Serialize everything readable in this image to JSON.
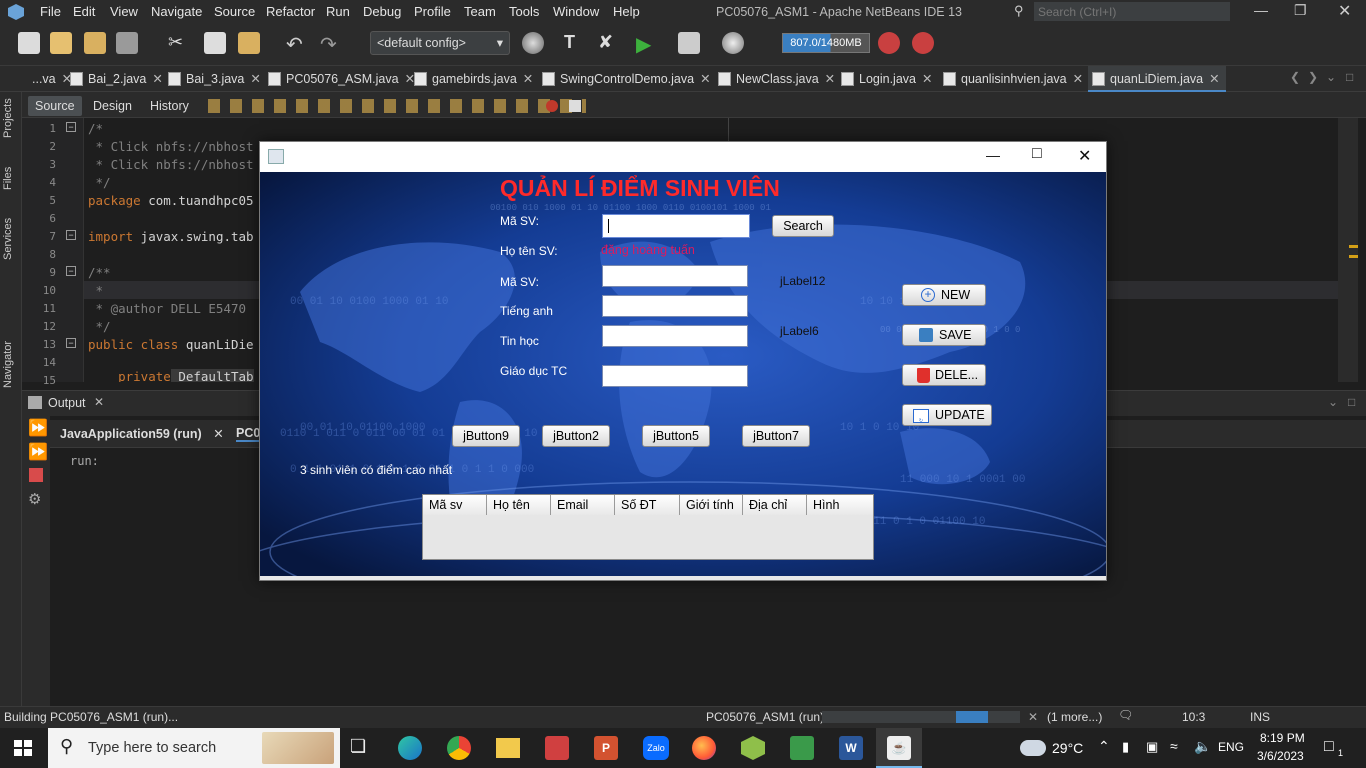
{
  "window": {
    "title": "PC05076_ASM1 - Apache NetBeans IDE 13",
    "search_placeholder": "Search (Ctrl+I)"
  },
  "menu": [
    "File",
    "Edit",
    "View",
    "Navigate",
    "Source",
    "Refactor",
    "Run",
    "Debug",
    "Profile",
    "Team",
    "Tools",
    "Window",
    "Help"
  ],
  "toolbar": {
    "config": "<default config>",
    "memory": "807.0/1480MB"
  },
  "editor_tabs": [
    "...va",
    "Bai_2.java",
    "Bai_3.java",
    "PC05076_ASM.java",
    "gamebirds.java",
    "SwingControlDemo.java",
    "NewClass.java",
    "Login.java",
    "quanlisinhvien.java",
    "quanLiDiem.java"
  ],
  "editor_subtabs": [
    "Source",
    "Design",
    "History"
  ],
  "side_tabs": [
    "Projects",
    "Files",
    "Services",
    "Navigator"
  ],
  "code": {
    "lines": [
      "1",
      "2",
      "3",
      "4",
      "5",
      "6",
      "7",
      "8",
      "9",
      "10",
      "11",
      "12",
      "13",
      "14",
      "15"
    ],
    "l1": "/*",
    "l2": " * Click nbfs://nbhost",
    "l3": " * Click nbfs://nbhost",
    "l4": " */",
    "l5a": "package",
    "l5b": " com.tuandhpc05",
    "l7a": "import",
    "l7b": " javax.swing.tab",
    "l9": "/**",
    "l10": " *",
    "l11": " * @author DELL E5470",
    "l12": " */",
    "l13a": "public class",
    "l13b": " quanLiDie",
    "l15a": "    private",
    "l15b": " DefaultTab"
  },
  "output": {
    "title": "Output",
    "tab1": "JavaApplication59 (run)",
    "tab2": "PC0",
    "text": "run:"
  },
  "status": {
    "left": "Building PC05076_ASM1 (run)...",
    "project": "PC05076_ASM1 (run)",
    "more": "(1 more...)",
    "pos": "10:3",
    "mode": "INS"
  },
  "taskbar": {
    "search": "Type here to search",
    "weather": "29°C",
    "lang": "ENG",
    "time": "8:19 PM",
    "date": "3/6/2023",
    "notif": "1"
  },
  "app": {
    "heading": "QUẢN LÍ ĐIỂM SINH VIÊN",
    "lbl_masv": "Mã SV:",
    "search": "Search",
    "lbl_hoten": "Họ tên SV:",
    "hoten_value": "đặng hoàng tuấn",
    "lbl_masv2": "Mã SV:",
    "jlabel12": "jLabel12",
    "lbl_tienganh": "Tiếng anh",
    "lbl_tinhoc": "Tin học",
    "jlabel6": "jLabel6",
    "lbl_gdtc": "Giáo dục TC",
    "btn_new": "NEW",
    "btn_save": "SAVE",
    "btn_delete": "DELE...",
    "btn_update": "UPDATE",
    "btn_j9": "jButton9",
    "btn_j2": "jButton2",
    "btn_j5": "jButton5",
    "btn_j7": "jButton7",
    "top3": "3 sinh viên có điểm cao nhất",
    "columns": [
      "Mã sv",
      "Họ tên",
      "Email",
      "Số ĐT",
      "Giới tính",
      "Địa chỉ",
      "Hình"
    ],
    "accent": "#ff2a2a",
    "name_color": "#d81b60"
  }
}
